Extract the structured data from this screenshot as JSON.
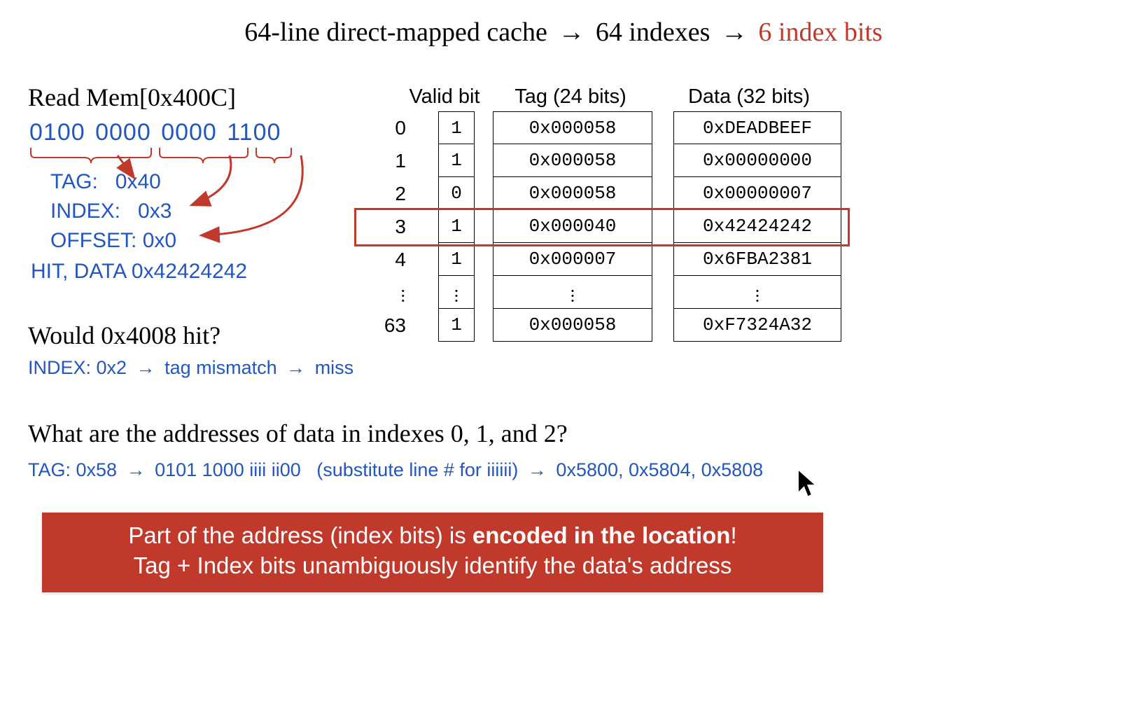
{
  "title": {
    "part1": "64-line direct-mapped cache",
    "arrow": "→",
    "part2": "64 indexes",
    "part3": "6 index bits"
  },
  "readmem": {
    "label": "Read Mem[0x400C]",
    "binary_groups": [
      "0100",
      "0000",
      "0000",
      "1100"
    ],
    "fields": {
      "tag_label": "TAG:",
      "tag_value": "0x40",
      "index_label": "INDEX:",
      "index_value": "0x3",
      "offset_label": "OFFSET:",
      "offset_value": "0x0"
    },
    "result": "HIT, DATA 0x42424242"
  },
  "question2": {
    "title": "Would 0x4008 hit?",
    "answer_parts": [
      "INDEX: 0x2",
      "tag mismatch",
      "miss"
    ],
    "arrow": "→"
  },
  "cache_table": {
    "headers": {
      "valid": "Valid bit",
      "tag": "Tag (24 bits)",
      "data": "Data (32 bits)"
    },
    "highlight_index": 3,
    "rows": [
      {
        "index": "0",
        "valid": "1",
        "tag": "0x000058",
        "data": "0xDEADBEEF"
      },
      {
        "index": "1",
        "valid": "1",
        "tag": "0x000058",
        "data": "0x00000000"
      },
      {
        "index": "2",
        "valid": "0",
        "tag": "0x000058",
        "data": "0x00000007"
      },
      {
        "index": "3",
        "valid": "1",
        "tag": "0x000040",
        "data": "0x42424242"
      },
      {
        "index": "4",
        "valid": "1",
        "tag": "0x000007",
        "data": "0x6FBA2381"
      },
      {
        "index": "",
        "valid": "",
        "tag": "",
        "data": "",
        "vdots": true
      },
      {
        "index": "63",
        "valid": "1",
        "tag": "0x000058",
        "data": "0xF7324A32"
      }
    ]
  },
  "question3": {
    "title": "What are the addresses of data in indexes 0, 1, and 2?",
    "ans_prefix": "TAG: 0x58",
    "arrow": "→",
    "ans_binary": "0101 1000 iiii ii00",
    "ans_note": "(substitute line # for iiiiii)",
    "ans_results": "0x5800, 0x5804, 0x5808"
  },
  "bottom_bar": {
    "line1_a": "Part of the address (index bits) is ",
    "line1_b": "encoded in the location",
    "line1_c": "!",
    "line2": "Tag + Index bits unambiguously identify the data's address"
  }
}
